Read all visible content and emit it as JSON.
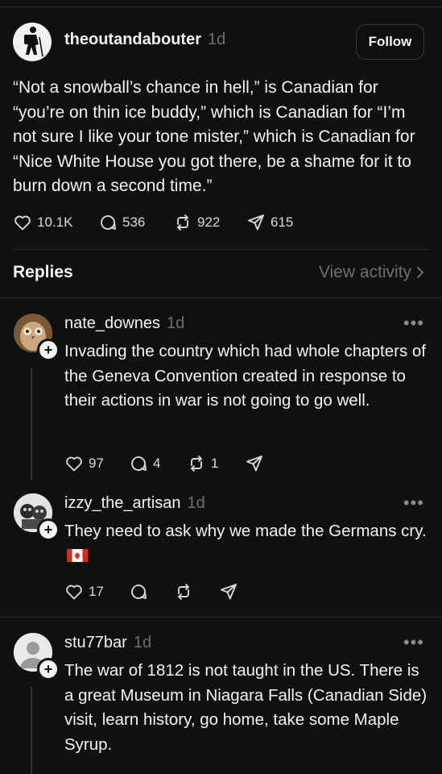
{
  "post": {
    "username": "theoutandabouter",
    "time": "1d",
    "follow_label": "Follow",
    "text": "“Not a snowball’s chance in hell,” is Canadian for “you’re on thin ice buddy,” which is Canadian for “I’m not sure I like your tone mister,” which is Canadian for “Nice White House you got there, be a shame for it to burn down a second time.”",
    "likes": "10.1K",
    "comments": "536",
    "reposts": "922",
    "shares": "615"
  },
  "replies_section": {
    "title": "Replies",
    "view_activity": "View activity"
  },
  "replies": [
    {
      "username": "nate_downes",
      "time": "1d",
      "text": "Invading the country which had whole chapters of the Geneva Convention created in response to their actions in war is not going to go well.",
      "likes": "97",
      "comments": "4",
      "reposts": "1"
    },
    {
      "username": "izzy_the_artisan",
      "time": "1d",
      "text": "They need to ask why we made the Germans cry.",
      "likes": "17"
    },
    {
      "username": "stu77bar",
      "time": "1d",
      "text": "The war of 1812 is not taught in the US. There is a great Museum in Niagara Falls (Canadian Side) visit, learn history, go home, take some Maple Syrup."
    }
  ],
  "icons": {
    "like": "heart-icon",
    "comment": "comment-icon",
    "repost": "repost-icon",
    "share": "share-icon",
    "more": "more-icon",
    "follow_plus": "plus-icon",
    "flag": "canada-flag-icon"
  },
  "colors": {
    "background": "#101010",
    "text": "#f3f3f3",
    "muted": "#6f6f6f",
    "divider": "#2a2a2a",
    "flag_red": "#d52b1e"
  }
}
